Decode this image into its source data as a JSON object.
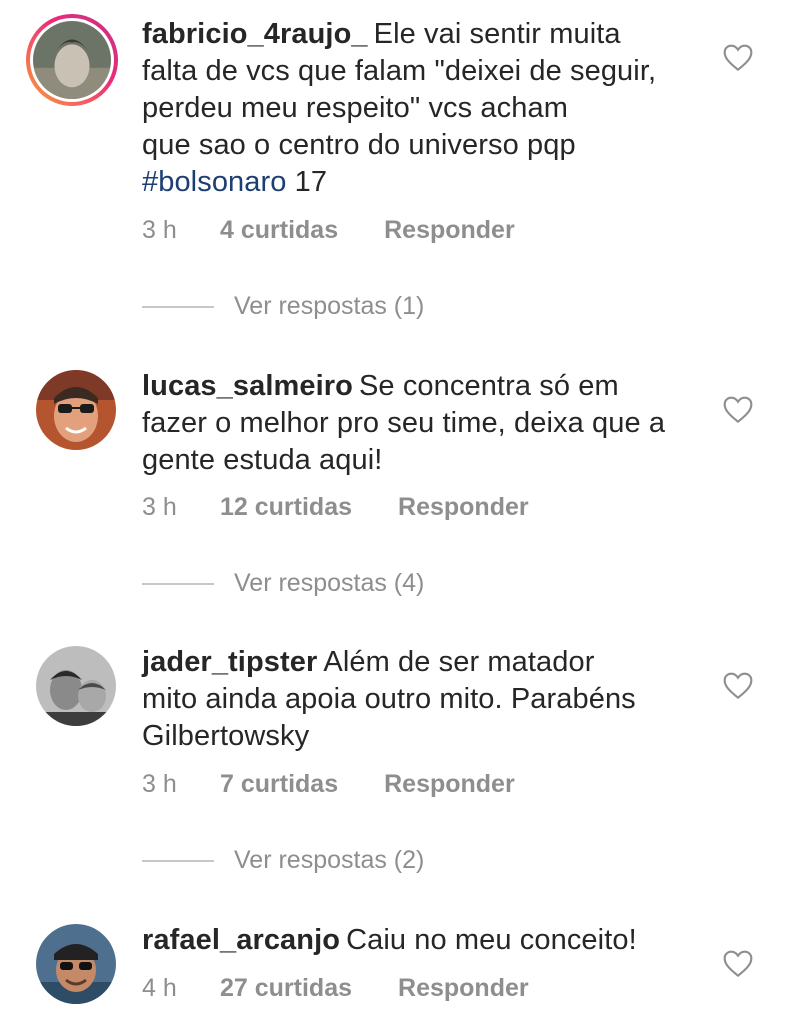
{
  "comments": [
    {
      "username": "fabricio_4raujo_",
      "text_lines": [
        "Ele vai sentir muita",
        "falta de vcs que falam \"deixei de seguir,",
        "perdeu meu respeito\" vcs acham",
        "que sao o centro do universo pqp"
      ],
      "hashtag": "#bolsonaro",
      "after_hashtag": " 17",
      "time": "3 h",
      "likes": "4 curtidas",
      "reply": "Responder",
      "view_replies": "Ver respostas (1)"
    },
    {
      "username": "lucas_salmeiro",
      "text_lines": [
        "Se concentra só em",
        "fazer o melhor pro seu time, deixa que a",
        "gente estuda aqui!"
      ],
      "time": "3 h",
      "likes": "12 curtidas",
      "reply": "Responder",
      "view_replies": "Ver respostas (4)"
    },
    {
      "username": "jader_tipster",
      "text_lines": [
        "Além de ser matador",
        "mito ainda apoia outro mito. Parabéns",
        "Gilbertowsky"
      ],
      "time": "3 h",
      "likes": "7 curtidas",
      "reply": "Responder",
      "view_replies": "Ver respostas (2)"
    },
    {
      "username": "rafael_arcanjo",
      "text_lines": [
        "Caiu no meu conceito!"
      ],
      "time": "4 h",
      "likes": "27 curtidas",
      "reply": "Responder"
    }
  ],
  "icons": {
    "like": "heart-outline-icon"
  },
  "colors": {
    "hashtag": "#1c3e72",
    "meta": "#8e8e8e",
    "text": "#262626"
  }
}
